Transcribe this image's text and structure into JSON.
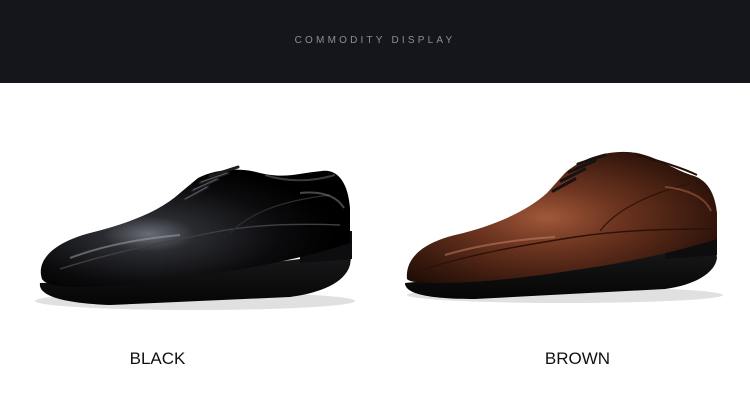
{
  "header": {
    "title": "COMMODITY DISPLAY"
  },
  "products": [
    {
      "label": "BLACK",
      "color_name": "black",
      "upper_color": "#0a0a0c",
      "highlight_color": "#5a5d66"
    },
    {
      "label": "BROWN",
      "color_name": "brown",
      "upper_color": "#5a2a17",
      "highlight_color": "#a0583a"
    }
  ],
  "colors": {
    "header_bg": "#15161c",
    "header_text": "#8c8e96",
    "page_bg": "#ffffff"
  }
}
